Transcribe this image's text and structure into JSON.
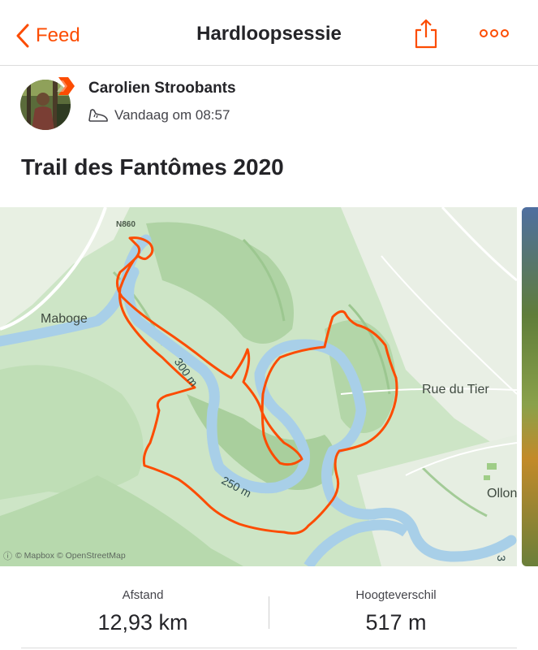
{
  "nav": {
    "back_label": "Feed",
    "title": "Hardloopsessie",
    "back_icon": "chevron-left-icon",
    "share_icon": "share-icon",
    "more_icon": "more-horizontal-icon"
  },
  "athlete": {
    "name": "Carolien Stroobants",
    "activity_icon": "run-shoe-icon",
    "timestamp": "Vandaag om 08:57"
  },
  "activity": {
    "title": "Trail des Fantômes 2020"
  },
  "map": {
    "road_tag": "N860",
    "places": {
      "maboge": "Maboge",
      "rue": "Rue du Tier",
      "ollon": "Ollon"
    },
    "contours": {
      "c300": "300 m",
      "c250": "250 m",
      "c3": "3"
    },
    "attribution": {
      "info": "ⓘ",
      "text": "© Mapbox © OpenStreetMap"
    }
  },
  "stats": [
    {
      "label": "Afstand",
      "value": "12,93 km"
    },
    {
      "label": "Hoogteverschil",
      "value": "517 m"
    }
  ],
  "colors": {
    "accent": "#fc4c02",
    "route": "#fc4c02",
    "river": "#a8cfe8",
    "terrain": "#c9e2c2"
  }
}
